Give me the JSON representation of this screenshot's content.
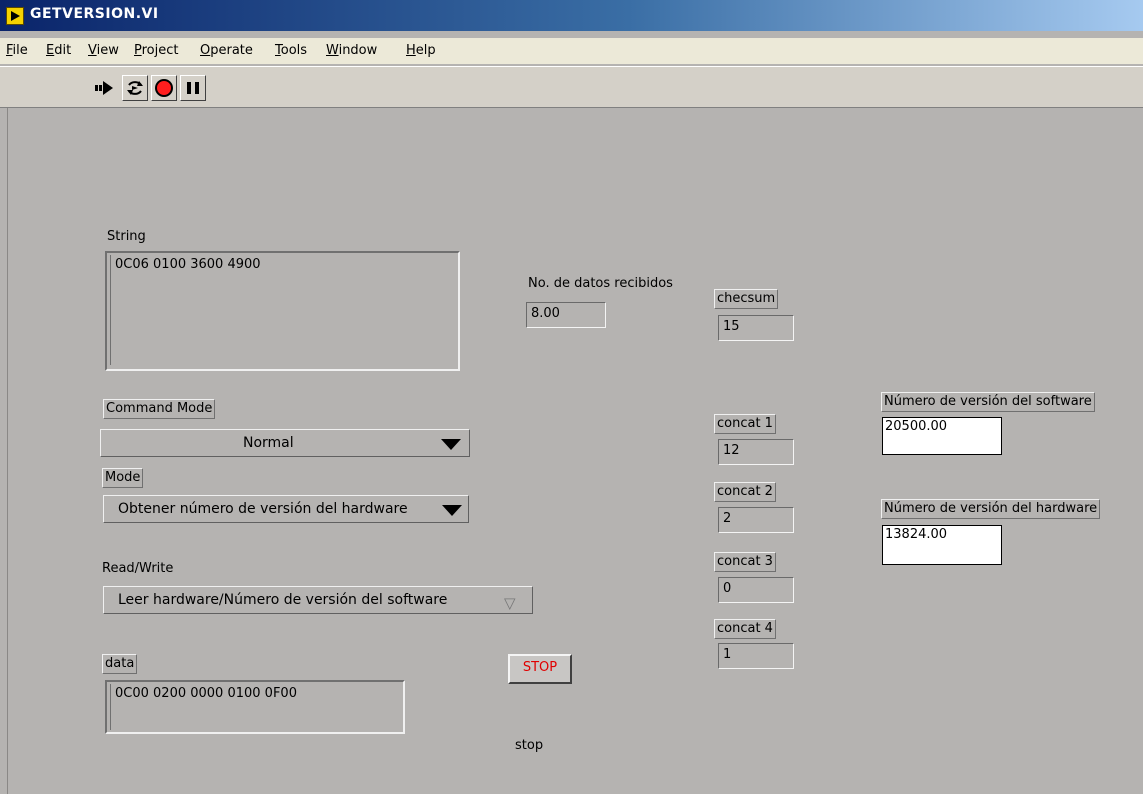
{
  "window": {
    "title": "GETVERSION.VI"
  },
  "menu": [
    "File",
    "Edit",
    "View",
    "Project",
    "Operate",
    "Tools",
    "Window",
    "Help"
  ],
  "menu_accel": [
    "F",
    "E",
    "V",
    "P",
    "O",
    "T",
    "W",
    "H"
  ],
  "toolbar": {
    "icons": [
      "run-arrow-icon",
      "run-continuously-icon",
      "abort-execution-icon",
      "pause-icon"
    ]
  },
  "controls": {
    "string": {
      "label": "String",
      "value": "0C06 0100 3600 4900"
    },
    "datos": {
      "label": "No. de datos recibidos",
      "value": "8.00"
    },
    "checksum": {
      "label": "checsum",
      "value": "15"
    },
    "command_mode": {
      "label": "Command Mode",
      "value": "Normal"
    },
    "mode": {
      "label": "Mode",
      "value": "Obtener número de versión del hardware"
    },
    "read_write": {
      "label": "Read/Write",
      "value": "Leer hardware/Número de versión del software"
    },
    "data": {
      "label": "data",
      "value": "0C00 0200 0000 0100 0F00"
    },
    "concat1": {
      "label": "concat 1",
      "value": "12"
    },
    "concat2": {
      "label": "concat 2",
      "value": "2"
    },
    "concat3": {
      "label": "concat 3",
      "value": "0"
    },
    "concat4": {
      "label": "concat 4",
      "value": "1"
    },
    "sw_version": {
      "label": "Número de versión del software",
      "value": "20500.00"
    },
    "hw_version": {
      "label": "Número de versión del hardware",
      "value": "13824.00"
    },
    "stop": {
      "label": "stop",
      "button": "STOP"
    }
  },
  "colors": {
    "panel": "#b5b3b1",
    "titlebar": "#0a246a",
    "stop_text": "#e00000"
  }
}
